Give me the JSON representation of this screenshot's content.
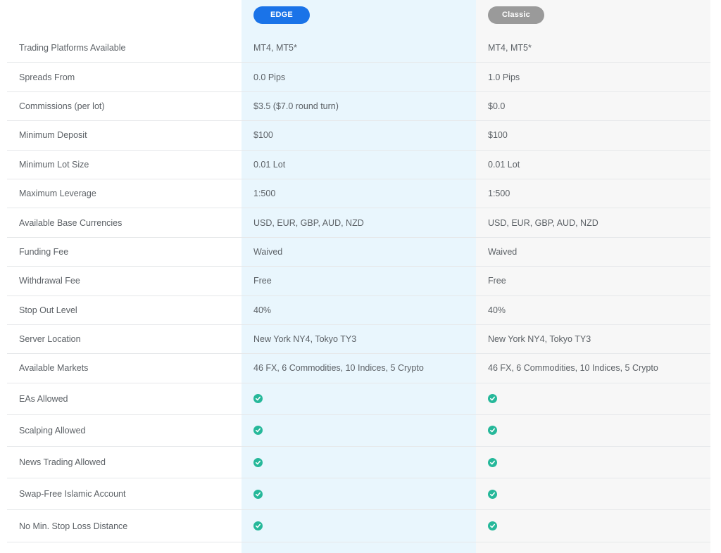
{
  "header": {
    "edge_label": "EDGE",
    "classic_label": "Classic"
  },
  "colors": {
    "edge_pill": "#1a73e8",
    "classic_pill": "#9a9a9a",
    "edge_column_bg": "#e9f6fd",
    "classic_column_bg": "#f7f7f7",
    "check": "#26b89a"
  },
  "rows": [
    {
      "label": "Trading Platforms Available",
      "edge": "MT4, MT5*",
      "classic": "MT4, MT5*"
    },
    {
      "label": "Spreads From",
      "edge": "0.0 Pips",
      "classic": "1.0 Pips"
    },
    {
      "label": "Commissions (per lot)",
      "edge": "$3.5 ($7.0 round turn)",
      "classic": "$0.0"
    },
    {
      "label": "Minimum Deposit",
      "edge": "$100",
      "classic": "$100"
    },
    {
      "label": "Minimum Lot Size",
      "edge": "0.01 Lot",
      "classic": "0.01 Lot"
    },
    {
      "label": "Maximum Leverage",
      "edge": "1:500",
      "classic": "1:500"
    },
    {
      "label": "Available Base Currencies",
      "edge": "USD, EUR, GBP, AUD, NZD",
      "classic": "USD, EUR, GBP, AUD, NZD"
    },
    {
      "label": "Funding Fee",
      "edge": "Waived",
      "classic": "Waived"
    },
    {
      "label": "Withdrawal Fee",
      "edge": "Free",
      "classic": "Free"
    },
    {
      "label": "Stop Out Level",
      "edge": "40%",
      "classic": "40%"
    },
    {
      "label": "Server Location",
      "edge": "New York NY4, Tokyo TY3",
      "classic": "New York NY4, Tokyo TY3"
    },
    {
      "label": "Available Markets",
      "edge": "46 FX, 6 Commodities, 10 Indices, 5 Crypto",
      "classic": "46 FX, 6 Commodities, 10 Indices, 5 Crypto"
    }
  ],
  "feature_rows": [
    {
      "label": "EAs Allowed",
      "edge_icon": "check-circle-icon",
      "classic_icon": "check-circle-icon"
    },
    {
      "label": "Scalping Allowed",
      "edge_icon": "check-circle-icon",
      "classic_icon": "check-circle-icon"
    },
    {
      "label": "News Trading Allowed",
      "edge_icon": "check-circle-icon",
      "classic_icon": "check-circle-icon"
    },
    {
      "label": "Swap-Free Islamic Account",
      "edge_icon": "check-circle-icon",
      "classic_icon": "check-circle-icon"
    },
    {
      "label": "No Min. Stop Loss Distance",
      "edge_icon": "check-circle-icon",
      "classic_icon": "check-circle-icon"
    }
  ]
}
